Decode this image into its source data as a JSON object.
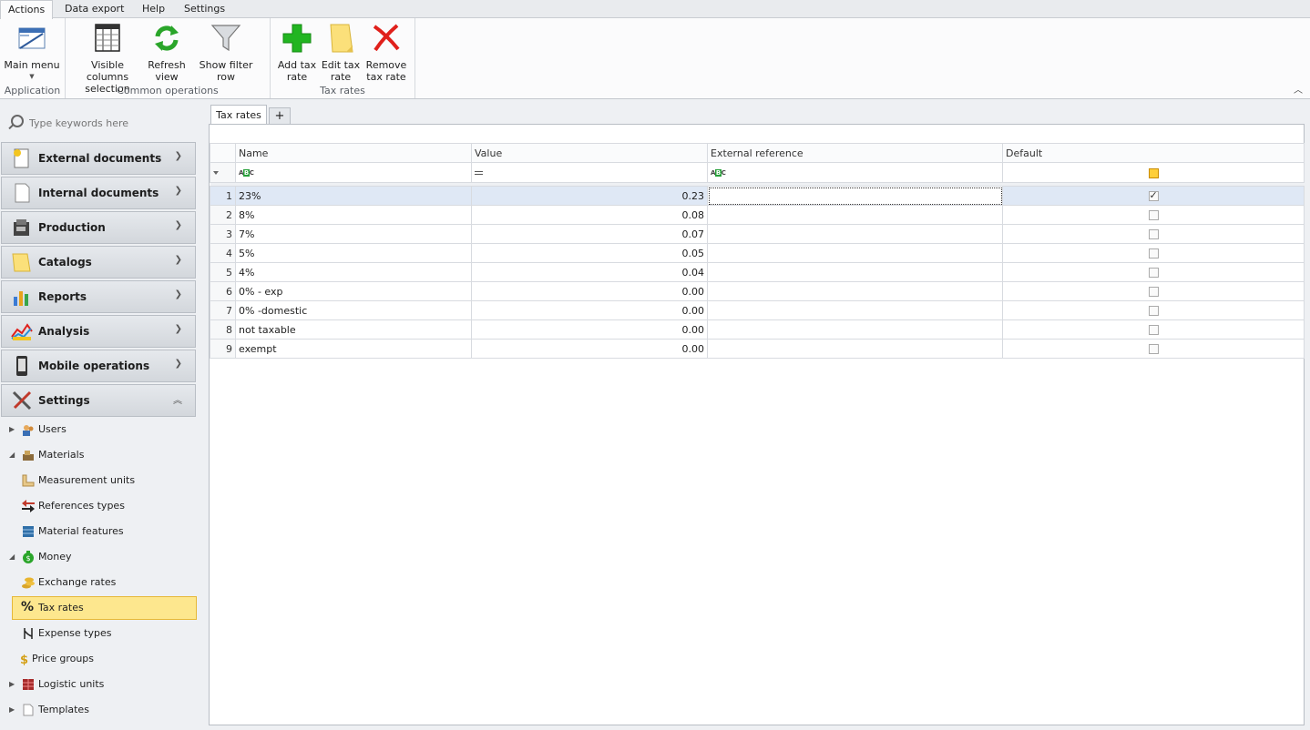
{
  "menu": {
    "tabs": [
      {
        "label": "Actions",
        "active": true
      },
      {
        "label": "Data export"
      },
      {
        "label": "Help"
      },
      {
        "label": "Settings"
      }
    ]
  },
  "ribbon": {
    "groups": {
      "application": "Application",
      "common": "Common operations",
      "tax": "Tax rates"
    },
    "buttons": {
      "main_menu": "Main menu",
      "visible_columns": "Visible columns\nselection",
      "refresh": "Refresh\nview",
      "filter_row": "Show filter row",
      "add_tax": "Add tax\nrate",
      "edit_tax": "Edit tax\nrate",
      "remove_tax": "Remove\ntax rate"
    }
  },
  "sidebar": {
    "search_placeholder": "Type keywords here",
    "sections": [
      {
        "label": "External documents",
        "icon": "external-documents-icon"
      },
      {
        "label": "Internal documents",
        "icon": "internal-documents-icon"
      },
      {
        "label": "Production",
        "icon": "production-icon"
      },
      {
        "label": "Catalogs",
        "icon": "catalogs-icon"
      },
      {
        "label": "Reports",
        "icon": "reports-icon"
      },
      {
        "label": "Analysis",
        "icon": "analysis-icon"
      },
      {
        "label": "Mobile operations",
        "icon": "mobile-operations-icon"
      },
      {
        "label": "Settings",
        "icon": "settings-icon",
        "expanded": true
      }
    ],
    "tree": [
      {
        "label": "Users",
        "icon": "users-icon",
        "level": 0
      },
      {
        "label": "Materials",
        "icon": "materials-icon",
        "level": 0,
        "expanded": true
      },
      {
        "label": "Measurement units",
        "icon": "measurement-units-icon",
        "level": 1
      },
      {
        "label": "References types",
        "icon": "references-types-icon",
        "level": 1
      },
      {
        "label": "Material features",
        "icon": "material-features-icon",
        "level": 1
      },
      {
        "label": "Money",
        "icon": "money-icon",
        "level": 0,
        "expanded": true
      },
      {
        "label": "Exchange rates",
        "icon": "exchange-rates-icon",
        "level": 1
      },
      {
        "label": "Tax rates",
        "icon": "percent-icon",
        "level": 1,
        "selected": true
      },
      {
        "label": "Expense types",
        "icon": "expense-types-icon",
        "level": 1
      },
      {
        "label": "Price groups",
        "icon": "price-groups-icon",
        "level": 0
      },
      {
        "label": "Logistic units",
        "icon": "logistic-units-icon",
        "level": 0
      },
      {
        "label": "Templates",
        "icon": "templates-icon",
        "level": 0
      }
    ]
  },
  "main": {
    "tab_label": "Tax rates",
    "add_tab": "+",
    "grid": {
      "columns": [
        "Name",
        "Value",
        "External reference",
        "Default"
      ],
      "rows": [
        {
          "n": "1",
          "name": "23%",
          "value": "0.23",
          "ext": "",
          "default": true
        },
        {
          "n": "2",
          "name": "8%",
          "value": "0.08",
          "ext": "",
          "default": false
        },
        {
          "n": "3",
          "name": "7%",
          "value": "0.07",
          "ext": "",
          "default": false
        },
        {
          "n": "4",
          "name": "5%",
          "value": "0.05",
          "ext": "",
          "default": false
        },
        {
          "n": "5",
          "name": "4%",
          "value": "0.04",
          "ext": "",
          "default": false
        },
        {
          "n": "6",
          "name": "0% - exp",
          "value": "0.00",
          "ext": "",
          "default": false
        },
        {
          "n": "7",
          "name": "0% -domestic",
          "value": "0.00",
          "ext": "",
          "default": false
        },
        {
          "n": "8",
          "name": "not taxable",
          "value": "0.00",
          "ext": "",
          "default": false
        },
        {
          "n": "9",
          "name": "exempt",
          "value": "0.00",
          "ext": "",
          "default": false
        }
      ]
    }
  },
  "colors": {
    "selected_row": "#dfe8f5",
    "selected_nav": "#fde78e",
    "add_green": "#22b521",
    "remove_red": "#e0201b"
  }
}
